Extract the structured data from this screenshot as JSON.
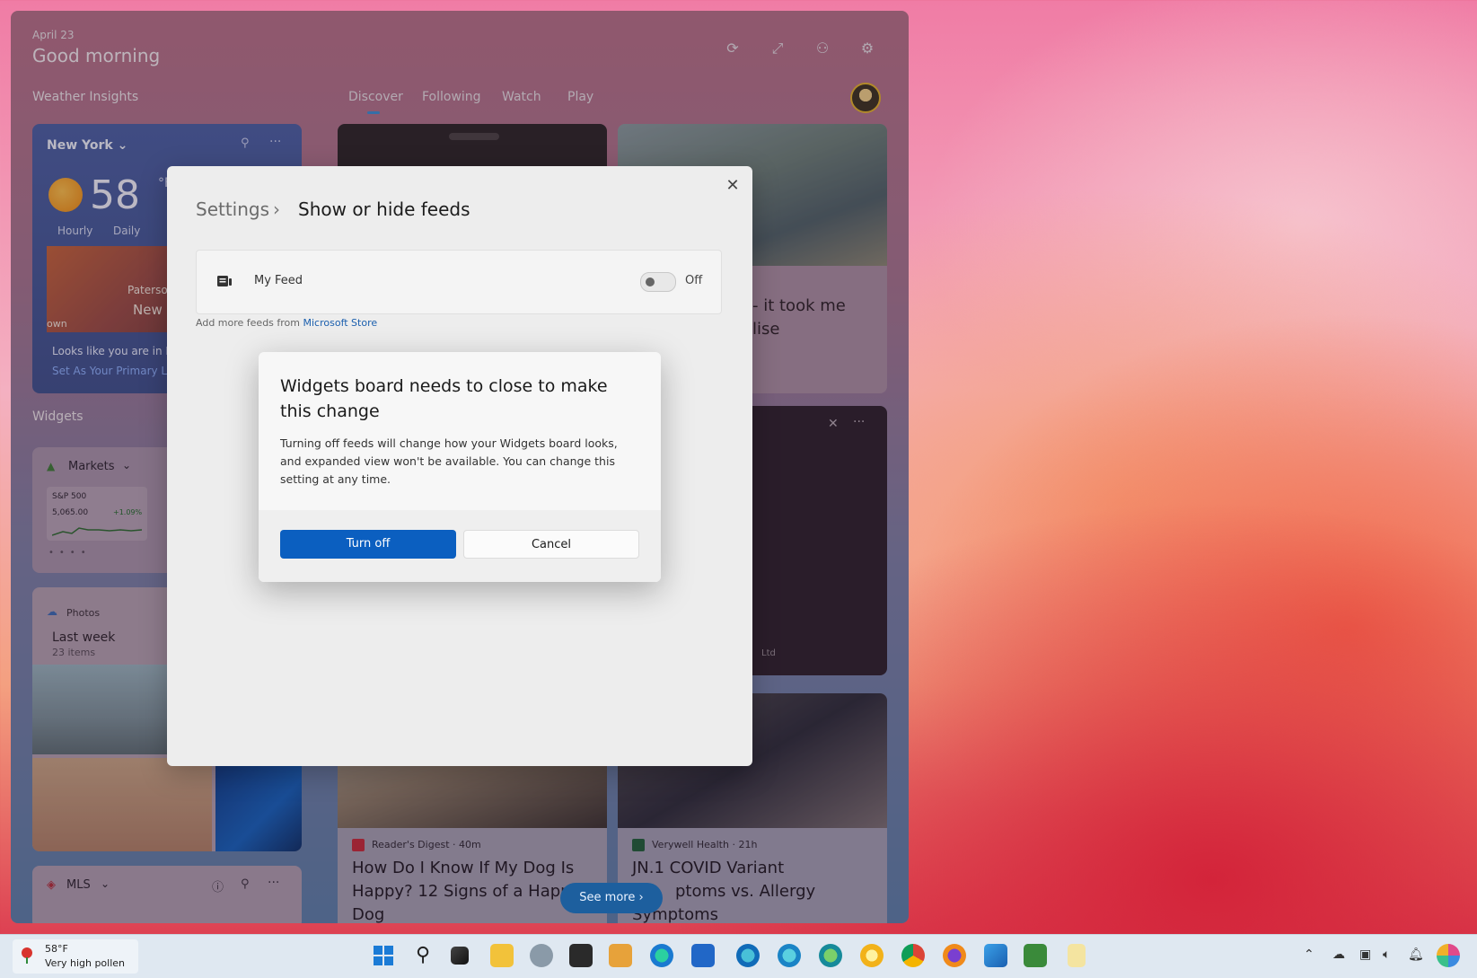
{
  "header": {
    "date": "April 23",
    "greeting": "Good morning",
    "icons": [
      "refresh-icon",
      "expand-icon",
      "people-icon",
      "gear-icon"
    ]
  },
  "sections": {
    "weather_insights": "Weather Insights",
    "widgets": "Widgets"
  },
  "tabs": [
    {
      "label": "Discover",
      "active": true
    },
    {
      "label": "Following",
      "active": false
    },
    {
      "label": "Watch",
      "active": false
    },
    {
      "label": "Play",
      "active": false
    }
  ],
  "weather": {
    "city": "New York",
    "temp": "58",
    "unit": "°F",
    "tab_hourly": "Hourly",
    "tab_daily": "Daily",
    "map_label_1": "Paterso",
    "map_label_2": "New",
    "map_label_3": "own",
    "message": "Looks like you are in No",
    "link": "Set As Your Primary Loc"
  },
  "markets": {
    "title": "Markets",
    "symbol": "S&P 500",
    "value": "5,065.00",
    "change": "+1.09%"
  },
  "photos": {
    "title": "Photos",
    "album": "Last week",
    "count": "23 items"
  },
  "mls": {
    "title": "MLS"
  },
  "news": {
    "headline_partial_1": "- it took me",
    "headline_partial_2": "lise",
    "credit_partial": "Ltd",
    "card1_source": "Reader's Digest",
    "card1_time": "· 40m",
    "card1_title_1": "How Do I Know If My Dog Is",
    "card1_title_2": "Happy? 12 Signs of a Happ",
    "card1_title_3": "Dog",
    "card2_source": "Verywell Health",
    "card2_time": "· 21h",
    "card2_title_1": "JN.1 COVID Variant",
    "card2_title_2": "ptoms vs. Allergy",
    "card2_title_3": "Symptoms",
    "see_more": "See more"
  },
  "settings": {
    "breadcrumb_root": "Settings",
    "breadcrumb_sep": "›",
    "breadcrumb_current": "Show or hide feeds",
    "feed_name": "My Feed",
    "toggle_label": "Off",
    "toggle_on": false,
    "more_text": "Add more feeds from ",
    "more_link": "Microsoft Store"
  },
  "modal": {
    "title": "Widgets board needs to close to make this change",
    "body": "Turning off feeds will change how your Widgets board looks, and expanded view won't be available. You can change this setting at any time.",
    "primary_button": "Turn off",
    "secondary_button": "Cancel"
  },
  "taskbar": {
    "weather_temp": "58°F",
    "weather_desc": "Very high pollen"
  },
  "colors": {
    "accent": "#0b5fc0",
    "link": "#1b5fae"
  }
}
